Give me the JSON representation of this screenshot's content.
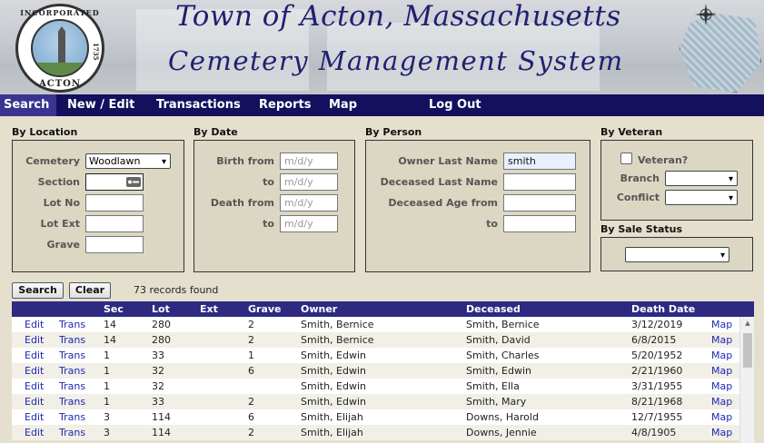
{
  "header": {
    "title": "Town of Acton, Massachusetts",
    "subtitle": "Cemetery Management System",
    "seal_top": "INCORPORATED",
    "seal_bottom": "ACTON",
    "seal_year": "1735"
  },
  "nav": {
    "items": [
      "Search",
      "New / Edit",
      "Transactions",
      "Reports",
      "Map",
      "Log Out"
    ],
    "active": "Search"
  },
  "by_location": {
    "title": "By Location",
    "cemetery_label": "Cemetery",
    "cemetery_value": "Woodlawn",
    "section_label": "Section",
    "section_value": "",
    "lot_no_label": "Lot No",
    "lot_ext_label": "Lot Ext",
    "grave_label": "Grave"
  },
  "by_date": {
    "title": "By Date",
    "birth_from_label": "Birth from",
    "to_label": "to",
    "death_from_label": "Death from",
    "placeholder": "m/d/y"
  },
  "by_person": {
    "title": "By Person",
    "owner_last_label": "Owner Last Name",
    "owner_last_value": "smith",
    "deceased_last_label": "Deceased Last Name",
    "deceased_age_from_label": "Deceased Age from",
    "to_label": "to"
  },
  "by_veteran": {
    "title": "By Veteran",
    "veteran_label": "Veteran?",
    "branch_label": "Branch",
    "conflict_label": "Conflict"
  },
  "by_sale_status": {
    "title": "By Sale Status"
  },
  "actions": {
    "search_label": "Search",
    "clear_label": "Clear",
    "records_found": "73 records found"
  },
  "table": {
    "columns": [
      "Sec",
      "Lot",
      "Ext",
      "Grave",
      "Owner",
      "Deceased",
      "Death Date"
    ],
    "edit_label": "Edit",
    "trans_label": "Trans",
    "map_label": "Map",
    "rows": [
      {
        "sec": "14",
        "lot": "280",
        "ext": "",
        "grave": "2",
        "owner": "Smith, Bernice",
        "deceased": "Smith, Bernice",
        "death_date": "3/12/2019"
      },
      {
        "sec": "14",
        "lot": "280",
        "ext": "",
        "grave": "2",
        "owner": "Smith, Bernice",
        "deceased": "Smith, David",
        "death_date": "6/8/2015"
      },
      {
        "sec": "1",
        "lot": "33",
        "ext": "",
        "grave": "1",
        "owner": "Smith, Edwin",
        "deceased": "Smith, Charles",
        "death_date": "5/20/1952"
      },
      {
        "sec": "1",
        "lot": "32",
        "ext": "",
        "grave": "6",
        "owner": "Smith, Edwin",
        "deceased": "Smith, Edwin",
        "death_date": "2/21/1960"
      },
      {
        "sec": "1",
        "lot": "32",
        "ext": "",
        "grave": "",
        "owner": "Smith, Edwin",
        "deceased": "Smith, Ella",
        "death_date": "3/31/1955"
      },
      {
        "sec": "1",
        "lot": "33",
        "ext": "",
        "grave": "2",
        "owner": "Smith, Edwin",
        "deceased": "Smith, Mary",
        "death_date": "8/21/1968"
      },
      {
        "sec": "3",
        "lot": "114",
        "ext": "",
        "grave": "6",
        "owner": "Smith, Elijah",
        "deceased": "Downs, Harold",
        "death_date": "12/7/1955"
      },
      {
        "sec": "3",
        "lot": "114",
        "ext": "",
        "grave": "2",
        "owner": "Smith, Elijah",
        "deceased": "Downs, Jennie",
        "death_date": "4/8/1905"
      }
    ]
  },
  "colors": {
    "nav_bg": "#14105e",
    "table_header_bg": "#2e2a82",
    "link": "#1f27b6",
    "title": "#1f2070",
    "page_bg": "#e4e0cd"
  }
}
